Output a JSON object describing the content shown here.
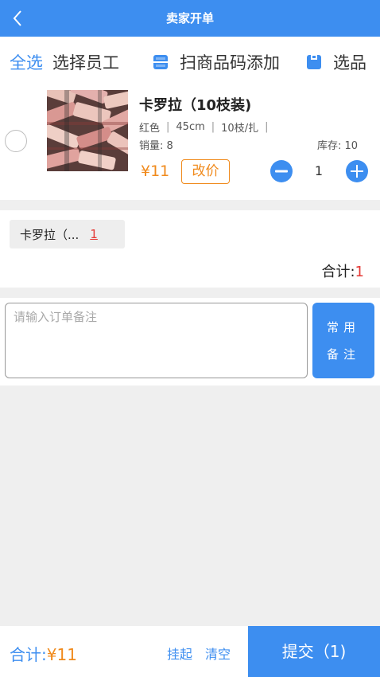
{
  "header": {
    "title": "卖家开单"
  },
  "toolbar": {
    "select_all": "全选",
    "select_staff": "选择员工",
    "scan_add": "扫商品码添加",
    "pick_goods": "选品"
  },
  "product": {
    "name": "卡罗拉（10枝装)",
    "attrs": [
      "红色",
      "45cm",
      "10枝/扎"
    ],
    "sales": "销量: 8",
    "stock": "库存: 10",
    "price": "¥11",
    "change_price": "改价",
    "quantity": "1"
  },
  "summary": {
    "tag_label": "卡罗拉（...",
    "tag_count": "1",
    "total_label": "合计:",
    "total_count": "1"
  },
  "remark": {
    "placeholder": "请输入订单备注",
    "common_label_1": "常用",
    "common_label_2": "备注"
  },
  "footer": {
    "total_label": "合计:",
    "total_amount": "¥11",
    "hang_label": "挂起",
    "clear_label": "清空",
    "submit_label": "提交（1)"
  },
  "colors": {
    "primary": "#3d8ef0",
    "price": "#f08a1c",
    "count": "#e53935"
  },
  "icons": {
    "back": "chevron-left-icon",
    "scan": "scan-icon",
    "pick": "clipboard-icon",
    "minus": "minus-circle-icon",
    "plus": "plus-circle-icon"
  }
}
